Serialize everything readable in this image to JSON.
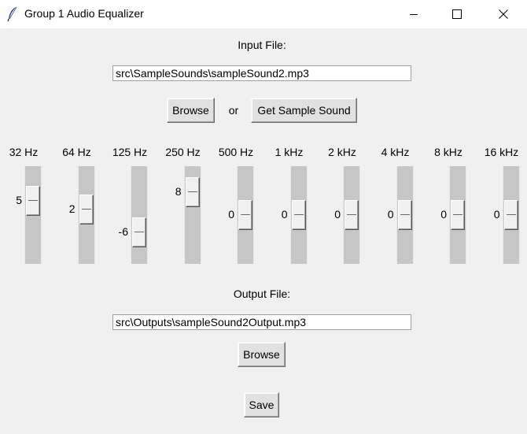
{
  "window": {
    "title": "Group 1 Audio Equalizer"
  },
  "input": {
    "label": "Input File:",
    "value": "src\\SampleSounds\\sampleSound2.mp3",
    "browse_label": "Browse",
    "or_label": "or",
    "sample_label": "Get Sample Sound"
  },
  "bands": [
    {
      "label": "32 Hz",
      "value": 5
    },
    {
      "label": "64 Hz",
      "value": 2
    },
    {
      "label": "125 Hz",
      "value": -6
    },
    {
      "label": "250 Hz",
      "value": 8
    },
    {
      "label": "500 Hz",
      "value": 0
    },
    {
      "label": "1 kHz",
      "value": 0
    },
    {
      "label": "2 kHz",
      "value": 0
    },
    {
      "label": "4 kHz",
      "value": 0
    },
    {
      "label": "8 kHz",
      "value": 0
    },
    {
      "label": "16 kHz",
      "value": 0
    }
  ],
  "output": {
    "label": "Output File:",
    "value": "src\\Outputs\\sampleSound2Output.mp3",
    "browse_label": "Browse"
  },
  "save_label": "Save"
}
